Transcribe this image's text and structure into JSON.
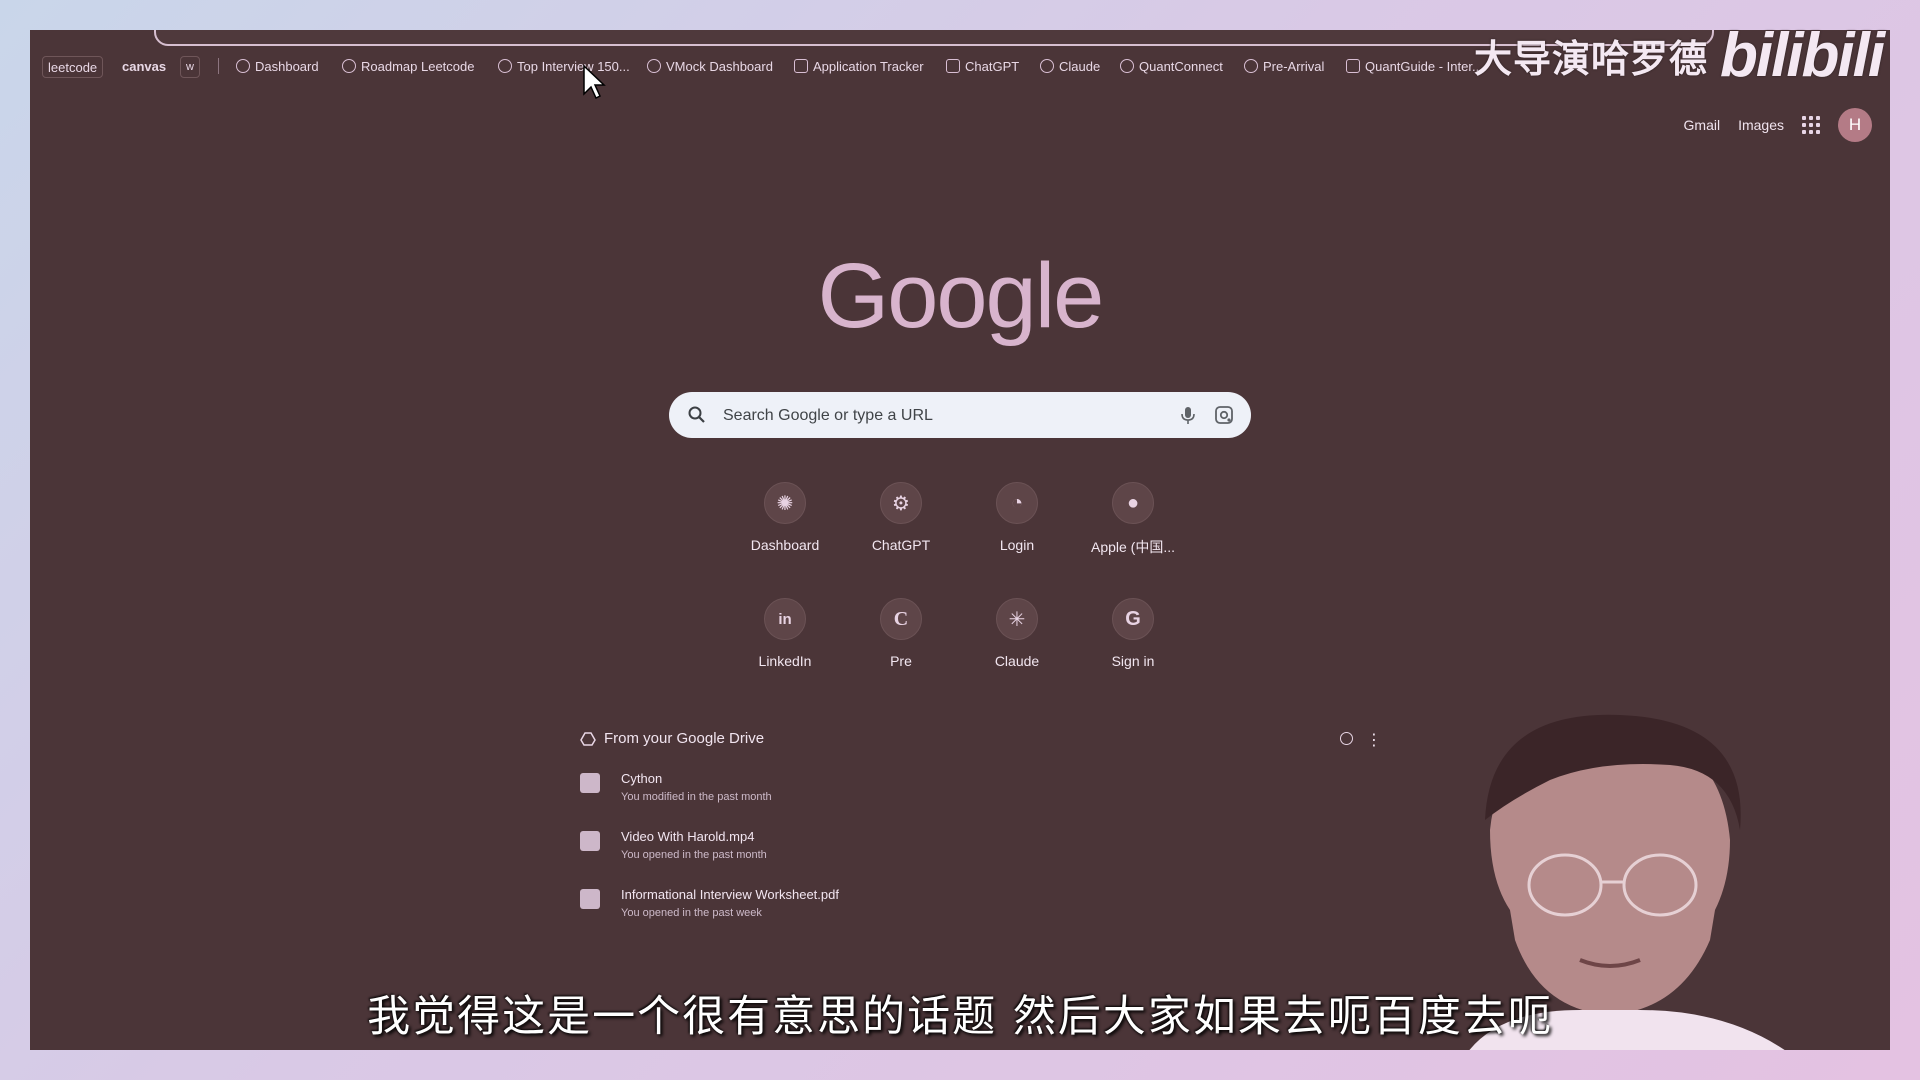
{
  "bookmarks": [
    {
      "label": "leetcode",
      "style": "boxed"
    },
    {
      "label": "canvas",
      "style": "plain"
    },
    {
      "label": "w",
      "style": "boxed"
    },
    {
      "label": "Dashboard",
      "icon": "dashboard-icon"
    },
    {
      "label": "Roadmap Leetcode",
      "icon": "rocket-icon"
    },
    {
      "label": "Top Interview 150...",
      "icon": "leetcode-icon"
    },
    {
      "label": "VMock Dashboard",
      "icon": "vmock-icon"
    },
    {
      "label": "Application Tracker",
      "icon": "tracker-icon"
    },
    {
      "label": "ChatGPT",
      "icon": "chatgpt-icon"
    },
    {
      "label": "Claude",
      "icon": "claude-icon"
    },
    {
      "label": "QuantConnect",
      "icon": "quantconnect-icon"
    },
    {
      "label": "Pre-Arrival",
      "icon": "globe-icon"
    },
    {
      "label": "QuantGuide - Inter...",
      "icon": "quantguide-icon"
    }
  ],
  "watermark": "大导演哈罗德",
  "bilibili": "bilibili",
  "header": {
    "gmail": "Gmail",
    "images": "Images",
    "avatar_letter": "H"
  },
  "logo": "Google",
  "search": {
    "placeholder": "Search Google or type a URL"
  },
  "shortcuts": [
    {
      "label": "Dashboard",
      "glyph": "✺"
    },
    {
      "label": "ChatGPT",
      "glyph": "⚙"
    },
    {
      "label": "Login",
      "glyph": "◔"
    },
    {
      "label": "Apple (中国...",
      "glyph": "●"
    },
    {
      "label": "LinkedIn",
      "glyph": "in"
    },
    {
      "label": "Pre",
      "glyph": "C"
    },
    {
      "label": "Claude",
      "glyph": "✳"
    },
    {
      "label": "Sign in",
      "glyph": "G"
    }
  ],
  "drive": {
    "title": "From your Google Drive",
    "items": [
      {
        "name": "Cython",
        "sub": "You modified in the past month",
        "icon": "doc-icon"
      },
      {
        "name": "Video With Harold.mp4",
        "sub": "You opened in the past month",
        "icon": "video-icon"
      },
      {
        "name": "Informational Interview Worksheet.pdf",
        "sub": "You opened in the past week",
        "icon": "pdf-icon"
      }
    ]
  },
  "subtitle": "我觉得这是一个很有意思的话题 然后大家如果去呃百度去呃",
  "colors": {
    "page_bg": "#4b3538",
    "accent": "#d8b4cd",
    "search_bg": "#eef1f8"
  }
}
